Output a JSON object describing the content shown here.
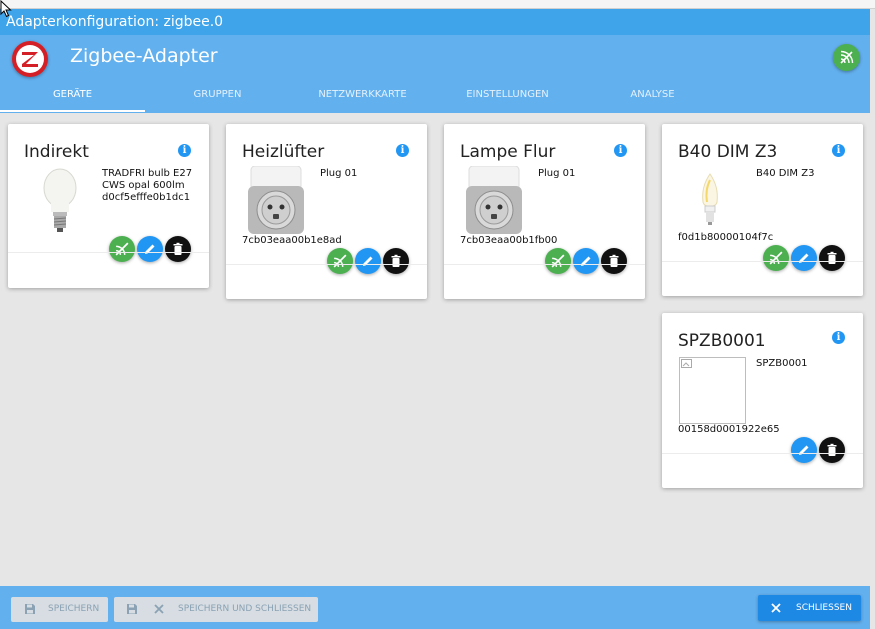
{
  "window": {
    "title": "Adapterkonfiguration: zigbee.0"
  },
  "header": {
    "app_title": "Zigbee-Adapter",
    "logo_icon": "zigbee-logo",
    "pair_icon": "zigbee-pair-icon"
  },
  "tabs": [
    {
      "label": "GERÄTE",
      "active": true
    },
    {
      "label": "GRUPPEN",
      "active": false
    },
    {
      "label": "NETZWERKKARTE",
      "active": false
    },
    {
      "label": "EINSTELLUNGEN",
      "active": false
    },
    {
      "label": "ANALYSE",
      "active": false
    }
  ],
  "devices": [
    {
      "name": "Indirekt",
      "model": "TRADFRI bulb E27 CWS opal 600lm",
      "model_lines": [
        "TRADFRI bulb E27",
        "CWS opal 600lm"
      ],
      "ieee": "d0cf5efffe0b1dc1",
      "image": "bulb-icon"
    },
    {
      "name": "Heizlüfter",
      "model": "Plug 01",
      "ieee": "7cb03eaa00b1e8ad",
      "image": "plug-icon"
    },
    {
      "name": "Lampe Flur",
      "model": "Plug 01",
      "ieee": "7cb03eaa00b1fb00",
      "image": "plug-icon"
    },
    {
      "name": "B40 DIM Z3",
      "model": "B40 DIM Z3",
      "ieee": "f0d1b80000104f7c",
      "image": "candle-bulb-icon"
    },
    {
      "name": "SPZB0001",
      "model": "SPZB0001",
      "ieee": "00158d0001922e65",
      "image": "broken-image-icon"
    }
  ],
  "footer": {
    "save_label": "SPEICHERN",
    "save_close_label": "SPEICHERN UND SCHLIESSEN",
    "close_label": "SCHLIESSEN"
  },
  "colors": {
    "header": "#63b0ee",
    "titlebar": "#3fa4ea",
    "green": "#4caf50",
    "blue": "#2196f3",
    "close_button": "#1e88e5"
  }
}
